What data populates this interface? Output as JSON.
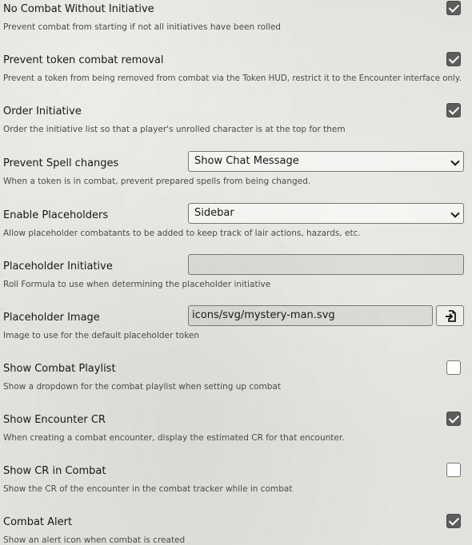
{
  "settings": [
    {
      "label": "No Combat Without Initiative",
      "hint": "Prevent combat from starting if not all initiatives have been rolled",
      "control": "checkbox",
      "checked": true
    },
    {
      "label": "Prevent token combat removal",
      "hint": "Prevent a token from being removed from combat via the Token HUD, restrict it to the Encounter interface only.",
      "control": "checkbox",
      "checked": true
    },
    {
      "label": "Order Initiative",
      "hint": "Order the initiative list so that a player's unrolled character is at the top for them",
      "control": "checkbox",
      "checked": true
    },
    {
      "label": "Prevent Spell changes",
      "hint": "When a token is in combat, prevent prepared spells from being changed.",
      "control": "select",
      "value": "Show Chat Message"
    },
    {
      "label": "Enable Placeholders",
      "hint": "Allow placeholder combatants to be added to keep track of lair actions, hazards, etc.",
      "control": "select",
      "value": "Sidebar"
    },
    {
      "label": "Placeholder Initiative",
      "hint": "Roll Formula to use when determining the placeholder initiative",
      "control": "text",
      "value": ""
    },
    {
      "label": "Placeholder Image",
      "hint": "Image to use for the default placeholder token",
      "control": "file",
      "value": "icons/svg/mystery-man.svg",
      "button_icon": "file-import-icon"
    },
    {
      "label": "Show Combat Playlist",
      "hint": "Show a dropdown for the combat playlist when setting up combat",
      "control": "checkbox",
      "checked": false
    },
    {
      "label": "Show Encounter CR",
      "hint": "When creating a combat encounter, display the estimated CR for that encounter.",
      "control": "checkbox",
      "checked": true
    },
    {
      "label": "Show CR in Combat",
      "hint": "Show the CR of the encounter in the combat tracker while in combat",
      "control": "checkbox",
      "checked": false
    },
    {
      "label": "Combat Alert",
      "hint": "Show an alert icon when combat is created",
      "control": "checkbox",
      "checked": true
    }
  ]
}
